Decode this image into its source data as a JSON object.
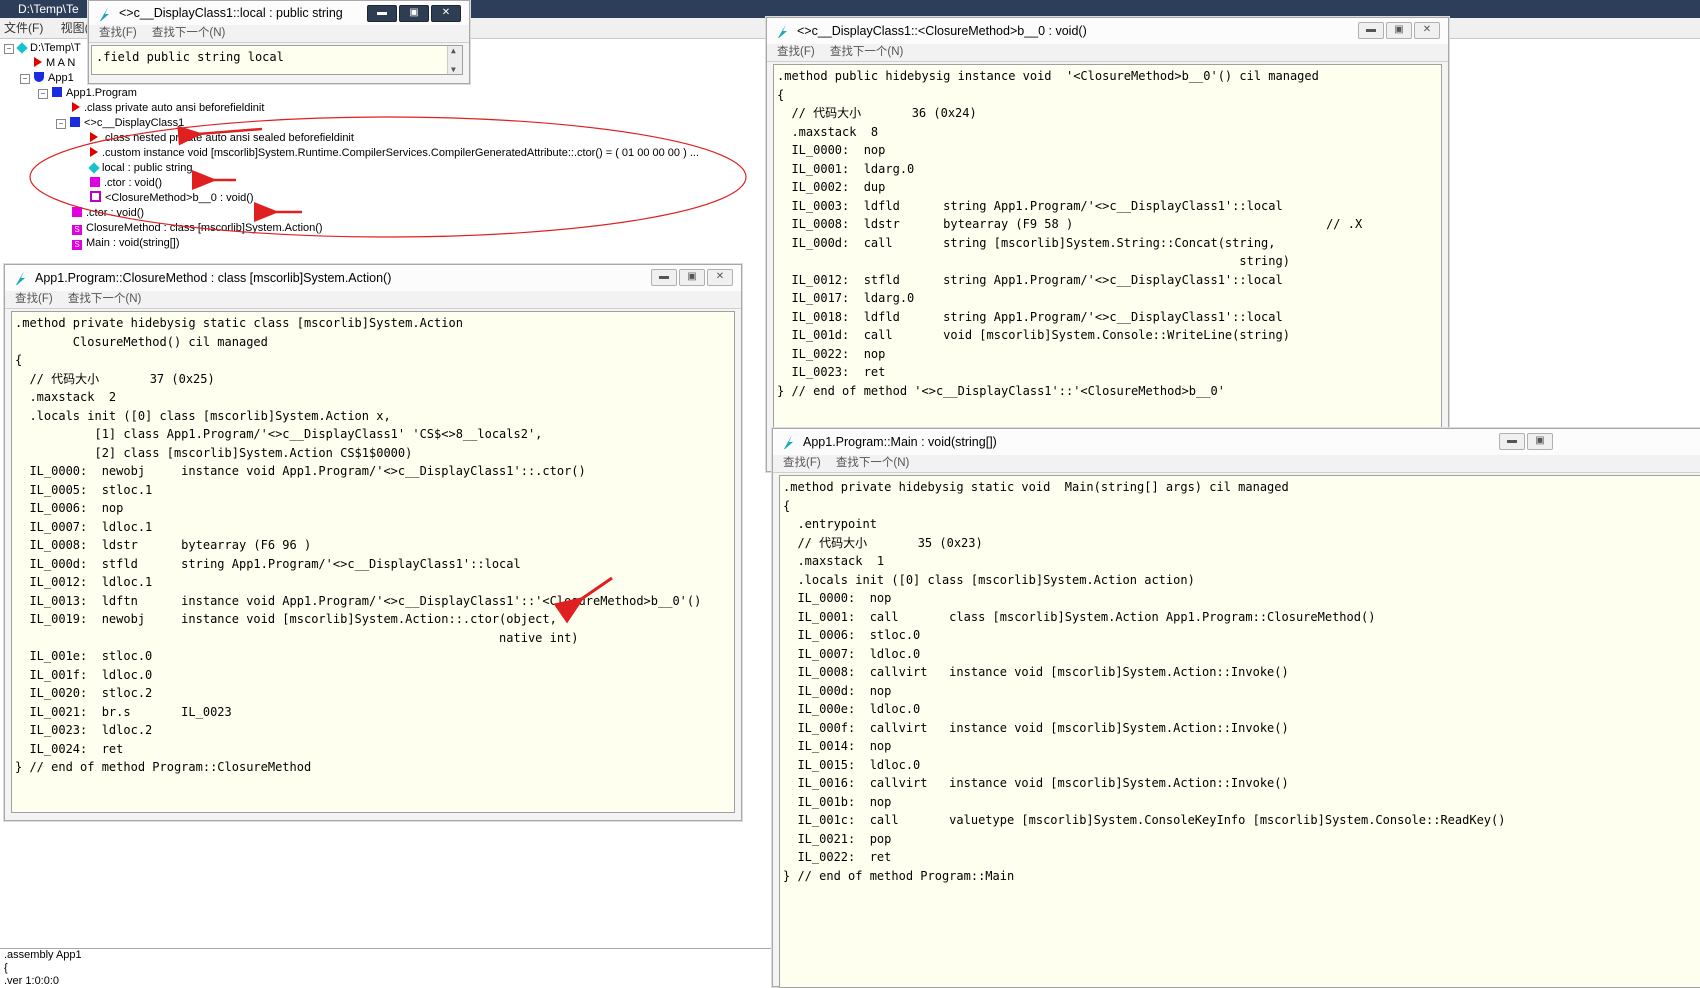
{
  "main_window": {
    "title": "D:\\Temp\\Te",
    "menu": [
      "文件(F)",
      "视图(V"
    ]
  },
  "tree": {
    "root": "D:\\Temp\\T",
    "manifest": "M A N",
    "module": "App1",
    "program": "App1.Program",
    "class_decl": ".class private auto ansi beforefieldinit",
    "display_class": "<>c__DisplayClass1",
    "display_class_children": [
      ".class nested private auto ansi sealed beforefieldinit",
      ".custom instance void [mscorlib]System.Runtime.CompilerServices.CompilerGeneratedAttribute::.ctor() = ( 01 00 00 00 ) ...",
      "local : public string",
      ".ctor : void()",
      "<ClosureMethod>b__0 : void()"
    ],
    "program_members": [
      ".ctor : void()",
      "ClosureMethod : class [mscorlib]System.Action()",
      "Main : void(string[])"
    ]
  },
  "bottom_panel": {
    "lines": [
      ".assembly App1",
      "{",
      "  .ver 1:0:0:0"
    ]
  },
  "win_field": {
    "title": "<>c__DisplayClass1::local : public string",
    "menu": [
      "查找(F)",
      "查找下一个(N)"
    ],
    "content": ".field public string local"
  },
  "win_closure_b0": {
    "title": "<>c__DisplayClass1::<ClosureMethod>b__0 : void()",
    "menu": [
      "查找(F)",
      "查找下一个(N)"
    ],
    "code": ".method public hidebysig instance void  '<ClosureMethod>b__0'() cil managed\n{\n  // 代码大小       36 (0x24)\n  .maxstack  8\n  IL_0000:  nop\n  IL_0001:  ldarg.0\n  IL_0002:  dup\n  IL_0003:  ldfld      string App1.Program/'<>c__DisplayClass1'::local\n  IL_0008:  ldstr      bytearray (F9 58 )                                   // .X\n  IL_000d:  call       string [mscorlib]System.String::Concat(string,\n                                                                string)\n  IL_0012:  stfld      string App1.Program/'<>c__DisplayClass1'::local\n  IL_0017:  ldarg.0\n  IL_0018:  ldfld      string App1.Program/'<>c__DisplayClass1'::local\n  IL_001d:  call       void [mscorlib]System.Console::WriteLine(string)\n  IL_0022:  nop\n  IL_0023:  ret\n} // end of method '<>c__DisplayClass1'::'<ClosureMethod>b__0'"
  },
  "win_closure_method": {
    "title": "App1.Program::ClosureMethod : class [mscorlib]System.Action()",
    "menu": [
      "查找(F)",
      "查找下一个(N)"
    ],
    "code": ".method private hidebysig static class [mscorlib]System.Action\n        ClosureMethod() cil managed\n{\n  // 代码大小       37 (0x25)\n  .maxstack  2\n  .locals init ([0] class [mscorlib]System.Action x,\n           [1] class App1.Program/'<>c__DisplayClass1' 'CS$<>8__locals2',\n           [2] class [mscorlib]System.Action CS$1$0000)\n  IL_0000:  newobj     instance void App1.Program/'<>c__DisplayClass1'::.ctor()\n  IL_0005:  stloc.1\n  IL_0006:  nop\n  IL_0007:  ldloc.1\n  IL_0008:  ldstr      bytearray (F6 96 )\n  IL_000d:  stfld      string App1.Program/'<>c__DisplayClass1'::local\n  IL_0012:  ldloc.1\n  IL_0013:  ldftn      instance void App1.Program/'<>c__DisplayClass1'::'<ClosureMethod>b__0'()\n  IL_0019:  newobj     instance void [mscorlib]System.Action::.ctor(object,\n                                                                   native int)\n  IL_001e:  stloc.0\n  IL_001f:  ldloc.0\n  IL_0020:  stloc.2\n  IL_0021:  br.s       IL_0023\n  IL_0023:  ldloc.2\n  IL_0024:  ret\n} // end of method Program::ClosureMethod"
  },
  "win_main": {
    "title": "App1.Program::Main : void(string[])",
    "menu": [
      "查找(F)",
      "查找下一个(N)"
    ],
    "code": ".method private hidebysig static void  Main(string[] args) cil managed\n{\n  .entrypoint\n  // 代码大小       35 (0x23)\n  .maxstack  1\n  .locals init ([0] class [mscorlib]System.Action action)\n  IL_0000:  nop\n  IL_0001:  call       class [mscorlib]System.Action App1.Program::ClosureMethod()\n  IL_0006:  stloc.0\n  IL_0007:  ldloc.0\n  IL_0008:  callvirt   instance void [mscorlib]System.Action::Invoke()\n  IL_000d:  nop\n  IL_000e:  ldloc.0\n  IL_000f:  callvirt   instance void [mscorlib]System.Action::Invoke()\n  IL_0014:  nop\n  IL_0015:  ldloc.0\n  IL_0016:  callvirt   instance void [mscorlib]System.Action::Invoke()\n  IL_001b:  nop\n  IL_001c:  call       valuetype [mscorlib]System.ConsoleKeyInfo [mscorlib]System.Console::ReadKey()\n  IL_0021:  pop\n  IL_0022:  ret\n} // end of method Program::Main"
  },
  "colors": {
    "code_background": "#fffff0",
    "annotation_red": "#e02020"
  }
}
